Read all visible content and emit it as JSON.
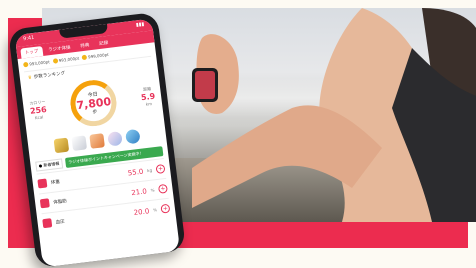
{
  "phone": {
    "status_time": "9:41",
    "tabs": [
      "トップ",
      "ラジオ体操",
      "特典",
      "記録"
    ],
    "points": [
      "993,000pt",
      "993,000pt",
      "999,000pt"
    ],
    "ranking_title": "歩数ランキング",
    "calorie_label": "カロリー",
    "calorie_value": "256",
    "calorie_unit": "Kcal",
    "today_label": "今日",
    "steps_value": "7,800",
    "steps_unit": "歩",
    "distance_label": "距離",
    "distance_value": "5.9",
    "distance_unit": "km",
    "notice_badge": "● 新着情報",
    "notice_text": "ラジオ体操ポイントキャンペーン実施中！",
    "rows": [
      {
        "label": "体重",
        "value": "55.0",
        "unit": "kg"
      },
      {
        "label": "体脂肪",
        "value": "21.0",
        "unit": "%"
      },
      {
        "label": "血圧",
        "value": "20.0",
        "unit": "%"
      }
    ]
  },
  "colors": {
    "brand": "#ec2c4f",
    "ring": "#f5a10c"
  }
}
